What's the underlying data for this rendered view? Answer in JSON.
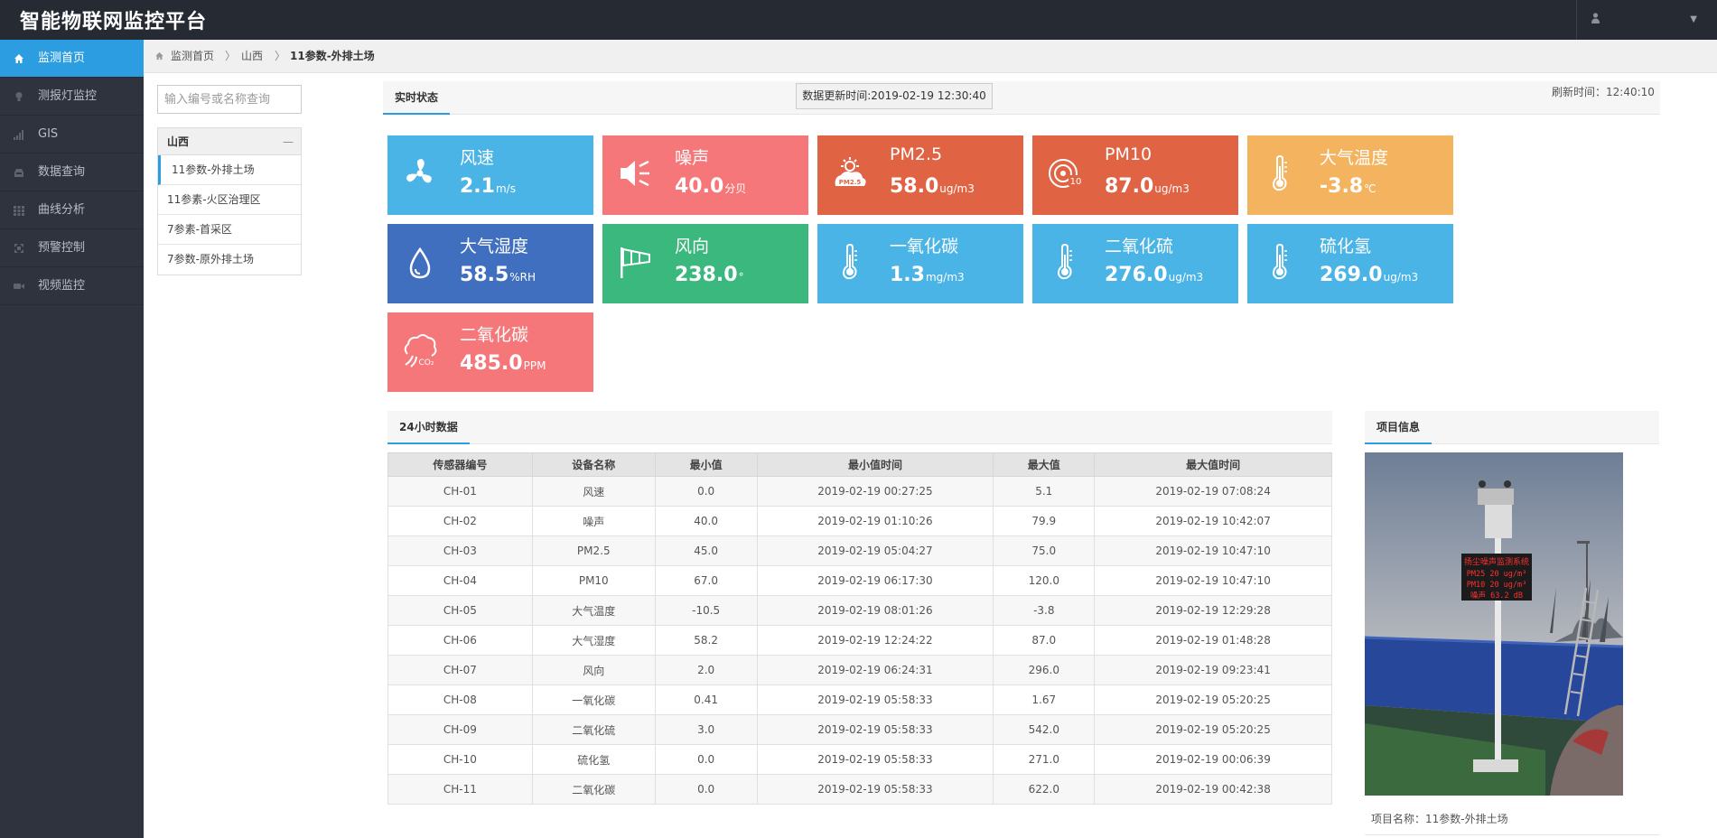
{
  "app": {
    "title": "智能物联网监控平台"
  },
  "header": {
    "user_icon": "user-icon",
    "dropdown_icon": "caret-down-icon"
  },
  "sidebar": {
    "items": [
      {
        "label": "监测首页",
        "icon": "home-icon",
        "active": true
      },
      {
        "label": "测报灯监控",
        "icon": "bulb-icon",
        "active": false
      },
      {
        "label": "GIS",
        "icon": "signal-icon",
        "active": false
      },
      {
        "label": "数据查询",
        "icon": "inbox-icon",
        "active": false
      },
      {
        "label": "曲线分析",
        "icon": "grid-icon",
        "active": false
      },
      {
        "label": "预警控制",
        "icon": "expand-icon",
        "active": false
      },
      {
        "label": "视频监控",
        "icon": "video-icon",
        "active": false
      }
    ]
  },
  "breadcrumb": {
    "items": [
      "监测首页",
      "山西",
      "11参数-外排土场"
    ]
  },
  "tree": {
    "search_placeholder": "输入编号或名称查询",
    "group": "山西",
    "collapse_symbol": "—",
    "items": [
      "11参数-外排土场",
      "11参素-火区治理区",
      "7参素-首采区",
      "7参数-原外排土场"
    ]
  },
  "realtime": {
    "tab": "实时状态",
    "update_time": "数据更新时间:2019-02-19 12:30:40",
    "refresh_time": "刷新时间：12:40:10",
    "tiles": [
      {
        "label": "风速",
        "value": "2.1",
        "unit": "m/s",
        "color": "#4ab4e6",
        "icon": "fan-icon"
      },
      {
        "label": "噪声",
        "value": "40.0",
        "unit": "分贝",
        "color": "#f5777a",
        "icon": "speaker-icon"
      },
      {
        "label": "PM2.5",
        "value": "58.0",
        "unit": "ug/m3",
        "color": "#e06443",
        "icon": "pm25-icon",
        "icon_text": "PM2.5"
      },
      {
        "label": "PM10",
        "value": "87.0",
        "unit": "ug/m3",
        "color": "#e06443",
        "icon": "pm10-icon",
        "icon_text": "10"
      },
      {
        "label": "大气温度",
        "value": "-3.8",
        "unit": "℃",
        "color": "#f4b35e",
        "icon": "thermometer-icon"
      },
      {
        "label": "大气湿度",
        "value": "58.5",
        "unit": "%RH",
        "color": "#3f6fbe",
        "icon": "droplet-icon"
      },
      {
        "label": "风向",
        "value": "238.0",
        "unit": "°",
        "color": "#3bb87e",
        "icon": "windsock-icon"
      },
      {
        "label": "一氧化碳",
        "value": "1.3",
        "unit": "mg/m3",
        "color": "#4ab4e6",
        "icon": "thermometer-icon"
      },
      {
        "label": "二氧化硫",
        "value": "276.0",
        "unit": "ug/m3",
        "color": "#4ab4e6",
        "icon": "thermometer-icon"
      },
      {
        "label": "硫化氢",
        "value": "269.0",
        "unit": "ug/m3",
        "color": "#4ab4e6",
        "icon": "thermometer-icon"
      },
      {
        "label": "二氧化碳",
        "value": "485.0",
        "unit": "PPM",
        "color": "#f5777a",
        "icon": "co2-cloud-icon",
        "icon_text": "CO₂"
      }
    ]
  },
  "history": {
    "tab": "24小时数据",
    "columns": [
      "传感器编号",
      "设备名称",
      "最小值",
      "最小值时间",
      "最大值",
      "最大值时间"
    ],
    "rows": [
      [
        "CH-01",
        "风速",
        "0.0",
        "2019-02-19 00:27:25",
        "5.1",
        "2019-02-19 07:08:24"
      ],
      [
        "CH-02",
        "噪声",
        "40.0",
        "2019-02-19 01:10:26",
        "79.9",
        "2019-02-19 10:42:07"
      ],
      [
        "CH-03",
        "PM2.5",
        "45.0",
        "2019-02-19 05:04:27",
        "75.0",
        "2019-02-19 10:47:10"
      ],
      [
        "CH-04",
        "PM10",
        "67.0",
        "2019-02-19 06:17:30",
        "120.0",
        "2019-02-19 10:47:10"
      ],
      [
        "CH-05",
        "大气温度",
        "-10.5",
        "2019-02-19 08:01:26",
        "-3.8",
        "2019-02-19 12:29:28"
      ],
      [
        "CH-06",
        "大气湿度",
        "58.2",
        "2019-02-19 12:24:22",
        "87.0",
        "2019-02-19 01:48:28"
      ],
      [
        "CH-07",
        "风向",
        "2.0",
        "2019-02-19 06:24:31",
        "296.0",
        "2019-02-19 09:23:41"
      ],
      [
        "CH-08",
        "一氧化碳",
        "0.41",
        "2019-02-19 05:58:33",
        "1.67",
        "2019-02-19 05:20:25"
      ],
      [
        "CH-09",
        "二氧化硫",
        "3.0",
        "2019-02-19 05:58:33",
        "542.0",
        "2019-02-19 05:20:25"
      ],
      [
        "CH-10",
        "硫化氢",
        "0.0",
        "2019-02-19 05:58:33",
        "271.0",
        "2019-02-19 00:06:39"
      ],
      [
        "CH-11",
        "二氧化碳",
        "0.0",
        "2019-02-19 05:58:33",
        "622.0",
        "2019-02-19 00:42:38"
      ]
    ]
  },
  "project": {
    "tab": "项目信息",
    "sign_text": [
      "扬尘噪声监测系统",
      "PM25  20 ug/m³",
      "PM10  20 ug/m³",
      "噪声  63.2 dB"
    ],
    "name_line": "项目名称：11参数-外排土场"
  }
}
